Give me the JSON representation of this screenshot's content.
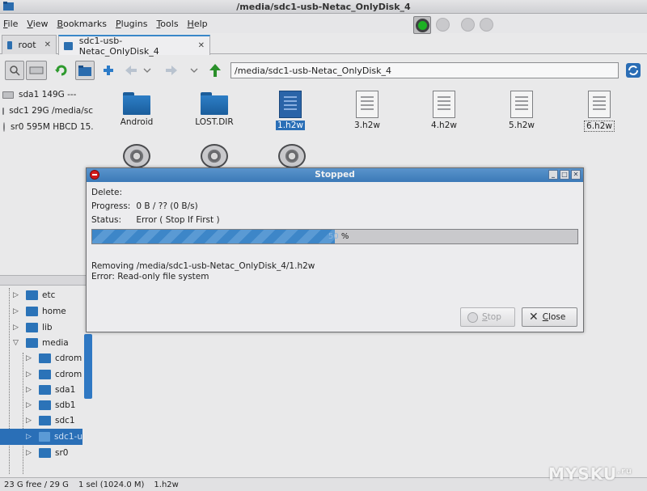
{
  "window": {
    "title": "/media/sdc1-usb-Netac_OnlyDisk_4"
  },
  "menu": [
    "File",
    "View",
    "Bookmarks",
    "Plugins",
    "Tools",
    "Help"
  ],
  "tabs": [
    {
      "label": "root"
    },
    {
      "label": "sdc1-usb-Netac_OnlyDisk_4"
    }
  ],
  "toolbar": {
    "path": "/media/sdc1-usb-Netac_OnlyDisk_4"
  },
  "devices": [
    {
      "label": "sda1 149G ---",
      "icon": "drive-icon"
    },
    {
      "label": "sdc1 29G /media/sc",
      "icon": "drive-icon"
    },
    {
      "label": "sr0 595M HBCD 15.:",
      "icon": "disc-icon"
    }
  ],
  "files": [
    {
      "name": "Android",
      "type": "folder"
    },
    {
      "name": "LOST.DIR",
      "type": "folder"
    },
    {
      "name": "1.h2w",
      "type": "file",
      "selected": true
    },
    {
      "name": "3.h2w",
      "type": "file"
    },
    {
      "name": "4.h2w",
      "type": "file"
    },
    {
      "name": "5.h2w",
      "type": "file"
    },
    {
      "name": "6.h2w",
      "type": "file",
      "focused": true
    }
  ],
  "tree": [
    {
      "label": "etc"
    },
    {
      "label": "home"
    },
    {
      "label": "lib"
    },
    {
      "label": "media"
    },
    {
      "label": "cdrom"
    },
    {
      "label": "cdrom"
    },
    {
      "label": "sda1"
    },
    {
      "label": "sdb1"
    },
    {
      "label": "sdc1"
    },
    {
      "label": "sdc1-u"
    },
    {
      "label": "sr0"
    }
  ],
  "status": {
    "free": "23 G free / 29 G",
    "sel": "1 sel (1024.0 M)",
    "file": "1.h2w"
  },
  "dialog": {
    "title": "Stopped",
    "delete_label": "Delete:",
    "progress_label": "Progress:",
    "progress_value": "0 B / ?? (0 B/s)",
    "status_label": "Status:",
    "status_value": "Error  ( Stop If First )",
    "percent": 50,
    "percent_text": "50",
    "percent_sign": "%",
    "message1": "Removing /media/sdc1-usb-Netac_OnlyDisk_4/1.h2w",
    "message2": "Error: Read-only file system",
    "stop_label": "Stop",
    "close_label": "Close"
  },
  "watermark": {
    "text": "MYSKU",
    "suffix": ".ru"
  }
}
